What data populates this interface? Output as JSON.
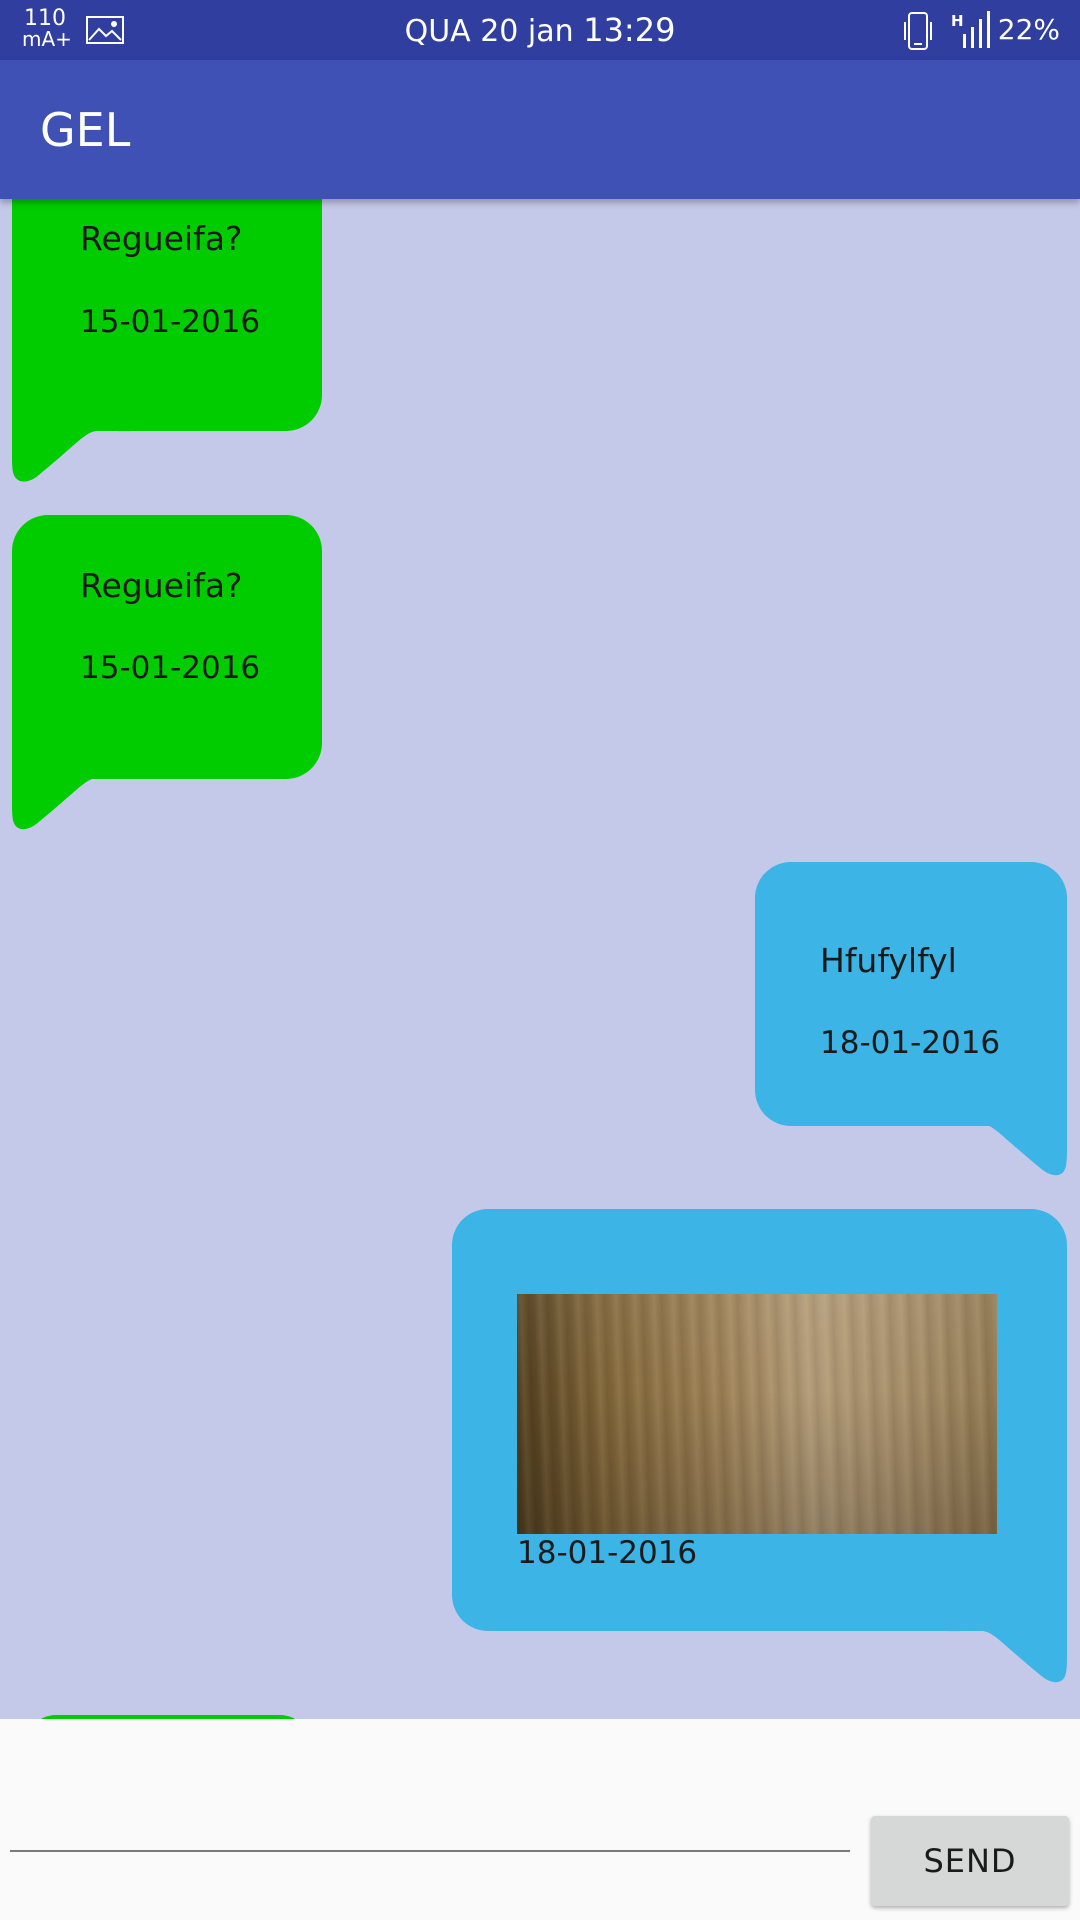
{
  "status_bar": {
    "current_value": "110",
    "current_unit": "mA+",
    "date": "QUA 20 jan",
    "time": "13:29",
    "network_type": "H",
    "battery": "22%",
    "icons": [
      "image-icon",
      "phone-icon",
      "signal-icon"
    ]
  },
  "app_bar": {
    "title": "GEL"
  },
  "messages": [
    {
      "direction": "incoming",
      "text": "Regueifa?",
      "date": "15-01-2016"
    },
    {
      "direction": "incoming",
      "text": "Regueifa?",
      "date": "15-01-2016"
    },
    {
      "direction": "outgoing",
      "text": "Hfufylfyl",
      "date": "18-01-2016"
    },
    {
      "direction": "outgoing",
      "image": "photo",
      "date": "18-01-2016"
    }
  ],
  "composer": {
    "input_value": "",
    "input_placeholder": "",
    "send_label": "SEND"
  },
  "colors": {
    "status_bar": "#303f9f",
    "app_bar": "#3f51b5",
    "chat_background": "#c5c9e9",
    "incoming_bubble": "#00cc00",
    "outgoing_bubble": "#3cb4e5"
  }
}
